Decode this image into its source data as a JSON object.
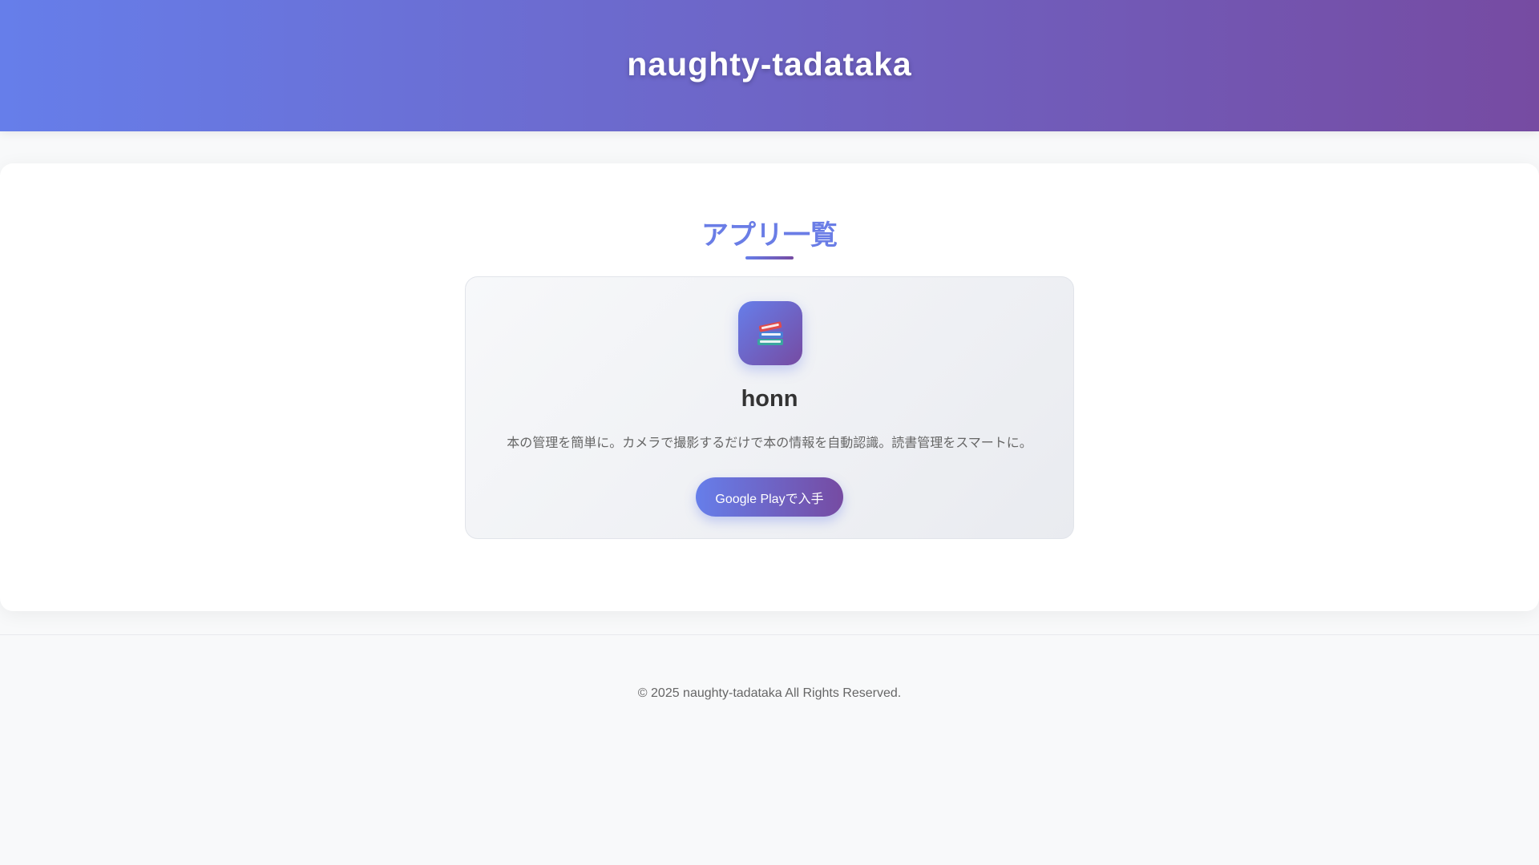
{
  "header": {
    "title": "naughty-tadataka"
  },
  "apps_section": {
    "title": "アプリ一覧",
    "apps": [
      {
        "icon": "books-icon",
        "name": "honn",
        "description": "本の管理を簡単に。カメラで撮影するだけで本の情報を自動認識。読書管理をスマートに。",
        "button_label": "Google Playで入手"
      }
    ]
  },
  "footer": {
    "copyright": "© 2025 naughty-tadataka All Rights Reserved."
  },
  "colors": {
    "header_gradient_start": "#667eea",
    "header_gradient_end": "#764ba2",
    "section_title": "#6a7de6",
    "page_background": "#f8f9fa"
  }
}
